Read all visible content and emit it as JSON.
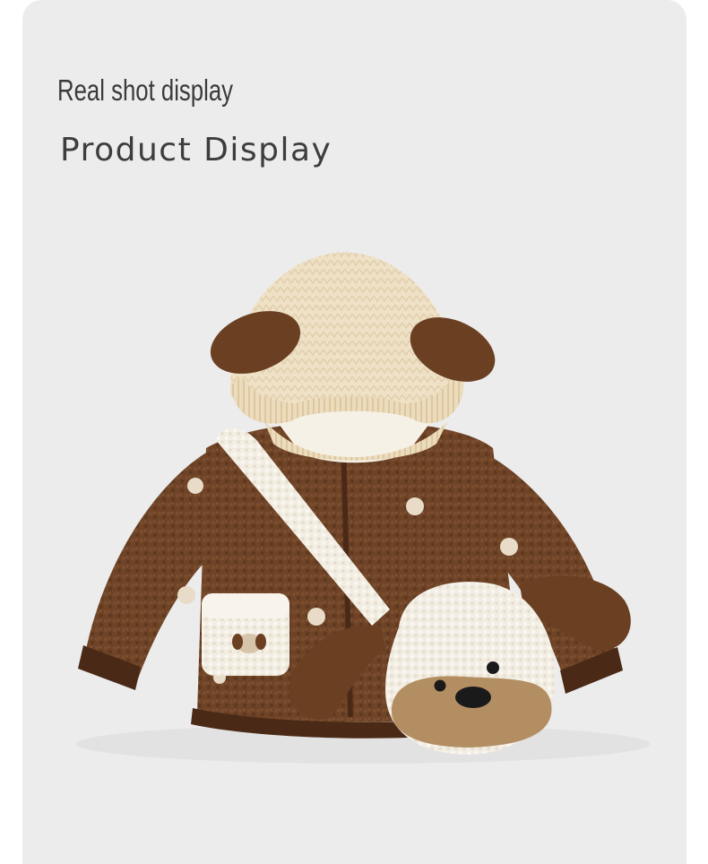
{
  "header": {
    "subtitle": "Real shot display",
    "title": "Product Display"
  },
  "colors": {
    "background": "#ececec",
    "fleece_brown": "#6b4124",
    "knit_cream": "#efe2c8",
    "bag_cream": "#f3ede2"
  },
  "product": {
    "description_icon": "brown-fleece-hooded-jacket-with-dog-bag"
  }
}
